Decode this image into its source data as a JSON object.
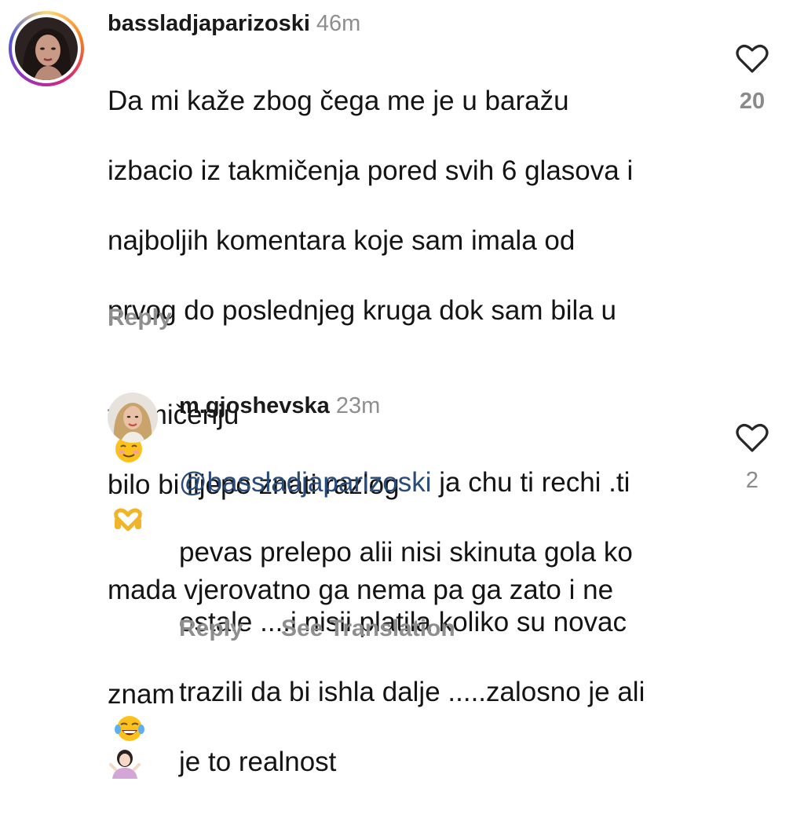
{
  "comment1": {
    "username": "bassladjaparizoski",
    "timestamp": "46m",
    "line1": "Da mi kaže zbog čega me je u baražu",
    "line2": "izbacio iz takmičenja pored svih 6 glasova i",
    "line3": "najboljih komentara koje sam imala od",
    "line4": "prvog do poslednjeg kruga dok sam bila u",
    "line5a": "takmičenju",
    "line5b": "bilo bi lijepo znati razlog",
    "line6": "mada vjerovatno ga nema pa ga zato i ne",
    "line7": "znam",
    "reply_label": "Reply",
    "like_count": "20",
    "avatar_icon": "profile-photo-woman-dark-hair",
    "emojis": [
      "smiling-face-with-blush",
      "heart-hands",
      "face-with-tears-of-joy",
      "woman-shrugging"
    ]
  },
  "comment2": {
    "username": "m.gjoshevska",
    "timestamp": "23m",
    "mention": "@bassladjaparizoski",
    "line1_rest": " ja chu ti rechi .ti",
    "line2": "pevas prelepo alii nisi skinuta gola ko",
    "line3": "ostale ....i nisii platila koliko su novac",
    "line4": "trazili da bi ishla dalje .....zalosno je ali",
    "line5": "je to realnost",
    "reply_label": "Reply",
    "translate_label": "See Translation",
    "like_count": "2",
    "avatar_icon": "profile-photo-woman-blonde"
  },
  "colors": {
    "text": "#141414",
    "muted": "#8e8e8e",
    "mention": "#284b7a",
    "heart_outline": "#262626"
  }
}
